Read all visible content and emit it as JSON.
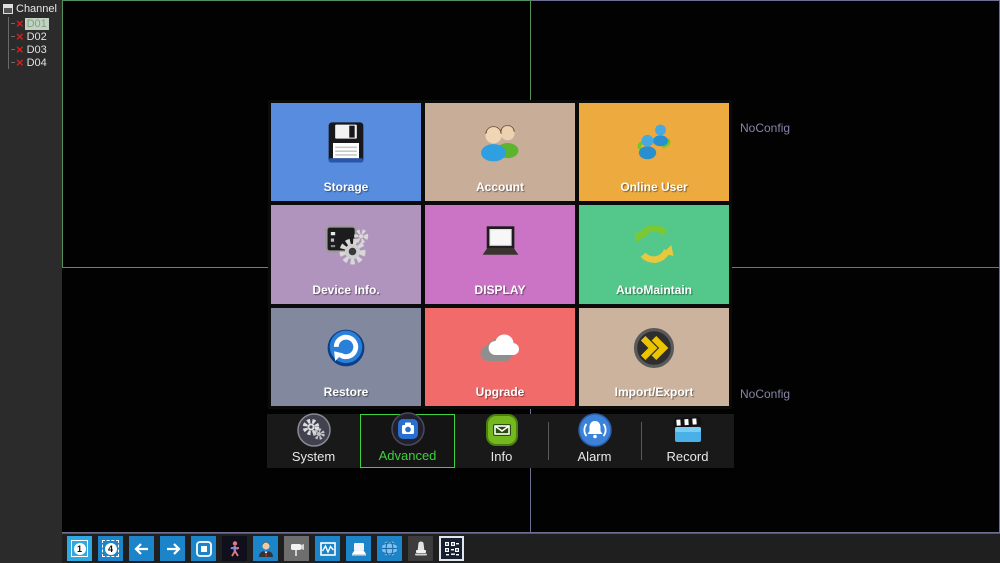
{
  "sidebar": {
    "header": "Channel",
    "channels": [
      {
        "label": "D01",
        "selected": true
      },
      {
        "label": "D02",
        "selected": false
      },
      {
        "label": "D03",
        "selected": false
      },
      {
        "label": "D04",
        "selected": false
      }
    ]
  },
  "video": {
    "channel_right_top_status": "NoConfig",
    "channel_right_bottom_status": "NoConfig",
    "selected_border_color": "#55915a",
    "divider_color": "#6e6e92"
  },
  "menu": {
    "tiles": [
      {
        "label": "Storage",
        "icon": "floppy-disk-icon",
        "color": "#578cdf"
      },
      {
        "label": "Account",
        "icon": "users-icon",
        "color": "#c8ae98"
      },
      {
        "label": "Online User",
        "icon": "online-users-icon",
        "color": "#edaa3e"
      },
      {
        "label": "Device Info.",
        "icon": "terminal-gear-icon",
        "color": "#b094bd"
      },
      {
        "label": "DISPLAY",
        "icon": "laptop-icon",
        "color": "#cb73c5"
      },
      {
        "label": "AutoMaintain",
        "icon": "recycle-icon",
        "color": "#54c88b"
      },
      {
        "label": "Restore",
        "icon": "restore-icon",
        "color": "#82889e"
      },
      {
        "label": "Upgrade",
        "icon": "cloud-icon",
        "color": "#f26b6b"
      },
      {
        "label": "Import/Export",
        "icon": "double-arrow-icon",
        "color": "#ccb39e"
      }
    ],
    "tabs": [
      {
        "label": "System",
        "icon": "gears-icon",
        "selected": false
      },
      {
        "label": "Advanced",
        "icon": "camera-icon",
        "selected": true
      },
      {
        "label": "Info",
        "icon": "mail-icon",
        "selected": false
      },
      {
        "label": "Alarm",
        "icon": "bell-icon",
        "selected": false
      },
      {
        "label": "Record",
        "icon": "clapper-icon",
        "selected": false
      }
    ],
    "selected_tab_color": "#3fd03f"
  },
  "toolbar": {
    "single_view_label": "1",
    "quad_view_label": "4",
    "buttons": [
      "single-view",
      "quad-view",
      "prev-channel",
      "next-channel",
      "monitor-view",
      "motion-figure",
      "user-avatar",
      "ptz-camera",
      "waveform-monitor",
      "laptop",
      "network-globe",
      "stamp",
      "binary-code"
    ]
  }
}
